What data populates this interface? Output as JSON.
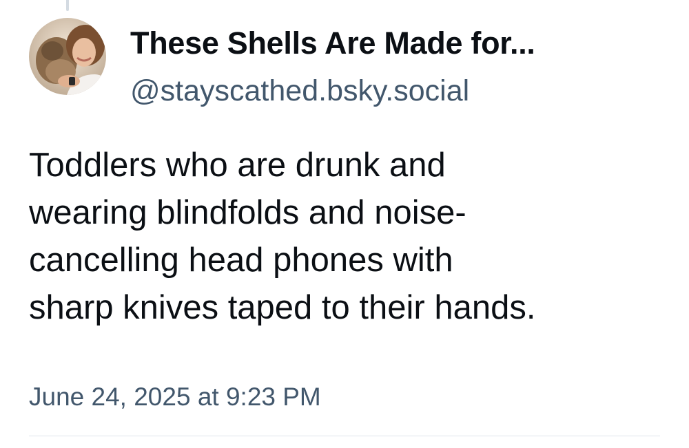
{
  "post": {
    "author": {
      "display_name": "These Shells Are Made for...",
      "handle": "@stayscathed.bsky.social",
      "avatar_icon": "user-avatar-photo"
    },
    "text_lines": [
      "Toddlers who are drunk and",
      "wearing blindfolds and noise-",
      "cancelling head phones with",
      "sharp knives taped to their hands."
    ],
    "timestamp": "June 24, 2025 at 9:23 PM"
  },
  "colors": {
    "primary_text": "#0b0f14",
    "secondary_text": "#42576c",
    "divider": "#dde3ea",
    "thread_line": "#d4dbe2"
  }
}
